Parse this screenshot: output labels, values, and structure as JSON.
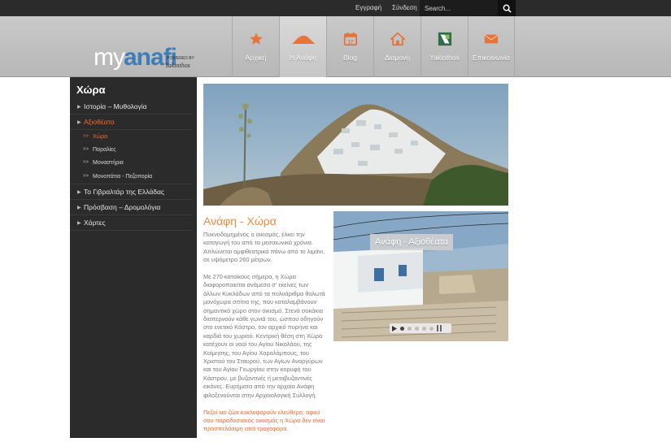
{
  "topbar": {
    "register": "Εγγραφή",
    "login": "Σύνδεση",
    "search_placeholder": "Search..."
  },
  "logo": {
    "my": "my",
    "anafi": "anafi",
    "powered": "POWERED BY",
    "yakinthos": "Yakinthos"
  },
  "nav": {
    "items": [
      {
        "label": "Αρχική",
        "icon": "star-icon"
      },
      {
        "label": "Η Ανάφη",
        "icon": "island-icon"
      },
      {
        "label": "Blog",
        "icon": "calendar-icon"
      },
      {
        "label": "Διαμονή",
        "icon": "home-icon"
      },
      {
        "label": "Yakinthos",
        "icon": "yakinthos-logo-icon"
      },
      {
        "label": "Επικοινωνία",
        "icon": "envelope-icon"
      }
    ],
    "active": 1
  },
  "sidebar": {
    "title": "Χώρα",
    "items": [
      {
        "label": "Ιστορία – Μυθολογία"
      },
      {
        "label": "Αξιοθέατα"
      },
      {
        "label": "Χώρα"
      },
      {
        "label": "Παραλίες"
      },
      {
        "label": "Μοναστήρια"
      },
      {
        "label": "Μονοπάτια - Πεζοπορία"
      },
      {
        "label": "Το Γιβραλτάρ της Ελλάδας"
      },
      {
        "label": "Πρόσβαση – Δρομολόγια"
      },
      {
        "label": "Χάρτες"
      }
    ],
    "sub_marker": ">>"
  },
  "content": {
    "title": "Ανάφη - Χώρα",
    "p1": "Πυκνοδομημένος ο οικισμός, έλκει την καταγωγή του από τα μεσαιωνικά χρόνια. Απλώνεται αμφιθεατρικά πάνω από το λιμάνι, σε υψόμετρο 260 μέτρων.",
    "p2": "Με 270 κατοίκους σήμερα, η Χώρα διαφοροποιείται ανάμεσα σ' εκείνες των άλλων Κυκλάδων από τα πολυάριθμα θολωτά μονόχωρα σπίτια της, που καταλαμβάνουν σημαντικό χώρο στον οικισμό. Στενά σοκάκια διαπερνούν κάθε γωνιά του, ώσπου οδηγούν στο ενετικό Κάστρο, τον αρχικό πυρήνα και καρδιά του χωριού. Κεντρική θέση στη Χώρα κατέχουν οι ναοί του Αγίου Νικολάου, της Κοίμησης, του Αγίου Χαραλάμπους, του Χριστού του Σταυρού, των Αγίων Αναργύρων και του Αγίου Γεωργίου στην κορυφή του Κάστρου, με βυζαντινές ή μεταβυζαντινές εικόνες. Ευρήματα από την αρχαία Ανάφη φιλοξενούνται στην Αρχαιολογική Συλλογή.",
    "p3": "Πεζοί και ζώα κυκλοφορούν ελεύθερα, αφού σαν παραδοσιακός οικισμός η Χώρα δεν είναι προσπελάσιμη από τροχοφόρα."
  },
  "slider": {
    "caption": "Ανάφη - Αξιοθέατα",
    "dots": 6,
    "active_dot": 0
  },
  "colors": {
    "accent": "#ef6a2e",
    "title_orange": "#ef8a3e",
    "logo_blue": "#3f7db8",
    "sidebar_bg": "#2b2b2b"
  }
}
